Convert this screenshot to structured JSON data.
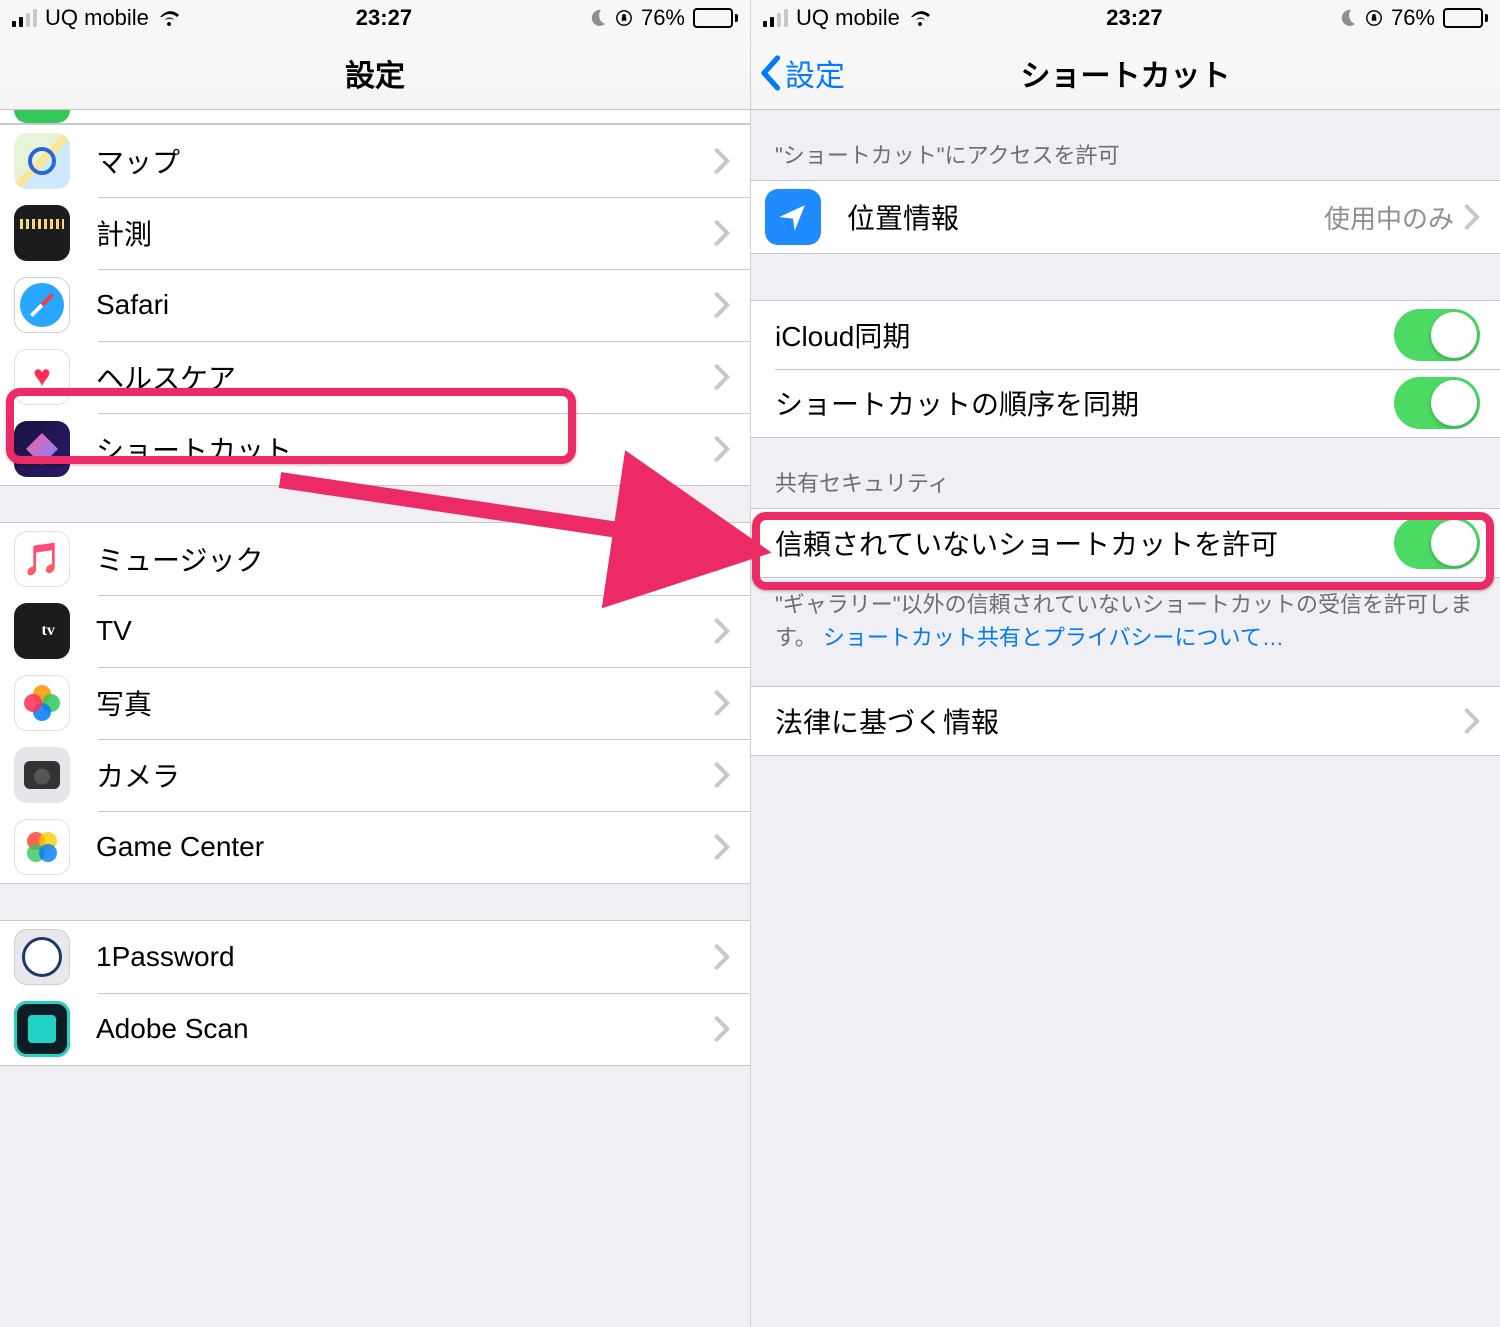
{
  "status": {
    "carrier": "UQ mobile",
    "time": "23:27",
    "battery_pct": "76%"
  },
  "left": {
    "title": "設定",
    "items_g1": [
      {
        "label": "マップ"
      },
      {
        "label": "計測"
      },
      {
        "label": "Safari"
      },
      {
        "label": "ヘルスケア"
      },
      {
        "label": "ショートカット"
      }
    ],
    "items_g2": [
      {
        "label": "ミュージック"
      },
      {
        "label": "TV"
      },
      {
        "label": "写真"
      },
      {
        "label": "カメラ"
      },
      {
        "label": "Game Center"
      }
    ],
    "items_g3": [
      {
        "label": "1Password"
      },
      {
        "label": "Adobe Scan"
      }
    ]
  },
  "right": {
    "back": "設定",
    "title": "ショートカット",
    "section_access": "\"ショートカット\"にアクセスを許可",
    "location_label": "位置情報",
    "location_value": "使用中のみ",
    "icloud_sync": "iCloud同期",
    "order_sync": "ショートカットの順序を同期",
    "section_security": "共有セキュリティ",
    "untrusted_label": "信頼されていないショートカットを許可",
    "footer_text": "\"ギャラリー\"以外の信頼されていないショートカットの受信を許可します。 ",
    "footer_link": "ショートカット共有とプライバシーについて…",
    "legal": "法律に基づく情報"
  }
}
